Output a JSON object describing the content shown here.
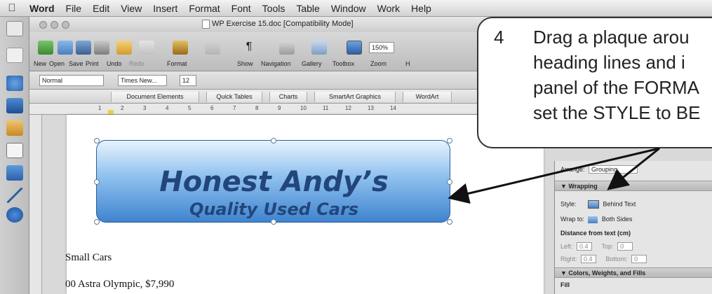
{
  "menubar": {
    "apple": "",
    "app": "Word",
    "items": [
      "File",
      "Edit",
      "View",
      "Insert",
      "Format",
      "Font",
      "Tools",
      "Table",
      "Window",
      "Work",
      "Help"
    ]
  },
  "window": {
    "title": "WP Exercise 15.doc [Compatibility Mode]"
  },
  "toolbar": {
    "buttons": [
      "New",
      "Open",
      "Save",
      "Print",
      "Undo",
      "Redo",
      "Format",
      "Show",
      "Navigation",
      "Gallery",
      "Toolbox",
      "Zoom",
      "H"
    ],
    "zoom_value": "150%"
  },
  "formatbar": {
    "style": "Normal",
    "font": "Times New...",
    "size": "12"
  },
  "ribbon": {
    "tabs": [
      "Document Elements",
      "Quick Tables",
      "Charts",
      "SmartArt Graphics",
      "WordArt"
    ]
  },
  "ruler": {
    "numbers": [
      "1",
      "2",
      "3",
      "4",
      "5",
      "6",
      "7",
      "8",
      "9",
      "10",
      "11",
      "12",
      "13",
      "14"
    ]
  },
  "document": {
    "heading": "Honest Andy’s",
    "subheading": "Quality Used Cars",
    "line1": "Small Cars",
    "line2": "00 Astra Olympic, $7,990"
  },
  "panel": {
    "arrange_label": "Arrange:",
    "arrange_value": "Grouping",
    "wrapping_header": "▼ Wrapping",
    "style_label": "Style:",
    "style_value": "Behind Text",
    "wrapto_label": "Wrap to:",
    "wrapto_value": "Both Sides",
    "distance_label": "Distance from text (cm)",
    "left_label": "Left:",
    "left_value": "0.4",
    "top_label": "Top:",
    "top_value": "0",
    "right_label": "Right:",
    "right_value": "0.4",
    "bottom_label": "Bottom:",
    "bottom_value": "0",
    "colors_header": "▼ Colors, Weights, and Fills",
    "fill_label": "Fill"
  },
  "callout": {
    "number": "4",
    "lines": [
      "Drag a plaque arou",
      "heading lines and i",
      "panel of the FORMA",
      "set the STYLE to BE"
    ]
  }
}
